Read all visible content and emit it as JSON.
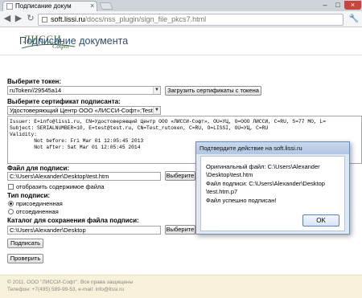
{
  "browser": {
    "tab_title": "Подписание докум",
    "tab_close": "×",
    "url_host": "soft.lissi.ru",
    "url_path": "/docs/nss_plugin/sign_file_pkcs7.html",
    "controls": {
      "minimize": "–",
      "maximize": "□",
      "close": "×"
    },
    "back": "◀",
    "forward": "▶",
    "reload": "↻",
    "menu": "🔧"
  },
  "logo": {
    "text": "ЛИССИ",
    "sub": "Софт"
  },
  "page": {
    "heading": "Подписание документа",
    "token": {
      "label": "Выберите токен:",
      "value": "ruToken//29545a14",
      "load_button": "Загрузить сертификаты с токена"
    },
    "certificate": {
      "label": "Выберите сертификат подписанта:",
      "value": "Удостоверяющий Центр ООО «ЛИССИ-Софт»;Test",
      "details": [
        "Issuer: E=info@lissi.ru, CN=Удостоверяющий Центр ООО «ЛИССИ-Софт», OU=УЦ, O=ООО ЛИССИ, C=RU, S=77 MO, L=",
        "Subject: SERIALNUMBER=10, E=test@test.ru, CN=Test_rutoken, C=RU, O=LISSI, OU=УЦ, C=RU",
        "Validity:",
        "        Not before: Fri Mar 01 12:05:45 2013",
        "        Not after: Sat Mar 01 12:05:45 2014"
      ]
    },
    "file": {
      "label": "Файл для подписи:",
      "value": "C:\\Users\\Alexander\\Desktop\\test.htm",
      "browse": "Выберите",
      "show_content": "отобразить содержимое файла"
    },
    "sign_type": {
      "label": "Тип подписи:",
      "options": [
        "присоединенная",
        "отсоединенная"
      ],
      "selected": "присоединенная"
    },
    "save_dir": {
      "label": "Каталог для сохранения файла подписи:",
      "value": "C:\\Users\\Alexander\\Desktop",
      "browse": "Выберите"
    },
    "sign_button": "Подписать",
    "verify_button": "Проверить"
  },
  "footer": {
    "line1": "© 2011. ООО \"ЛИССИ-Софт\". Все права защищены",
    "line2": "Телефон: +7(495) 589-99-53, e-mail: info@lissi.ru"
  },
  "dialog": {
    "title": "Подтвердите действие на soft.lissi.ru",
    "lines": [
      "Оригинальный файл: C:\\Users\\Alexander",
      "\\Desktop\\test.htm",
      "Файл подписи: C:\\Users\\Alexander\\Desktop",
      "\\test.htm.p7",
      "Файл успешно подписан!"
    ],
    "ok": "OK"
  },
  "colors": {
    "heading": "#2d4d75",
    "footer_bg": "#f7f1da",
    "dialog_title": "#b0c6e3",
    "close_button": "#c7463e"
  }
}
